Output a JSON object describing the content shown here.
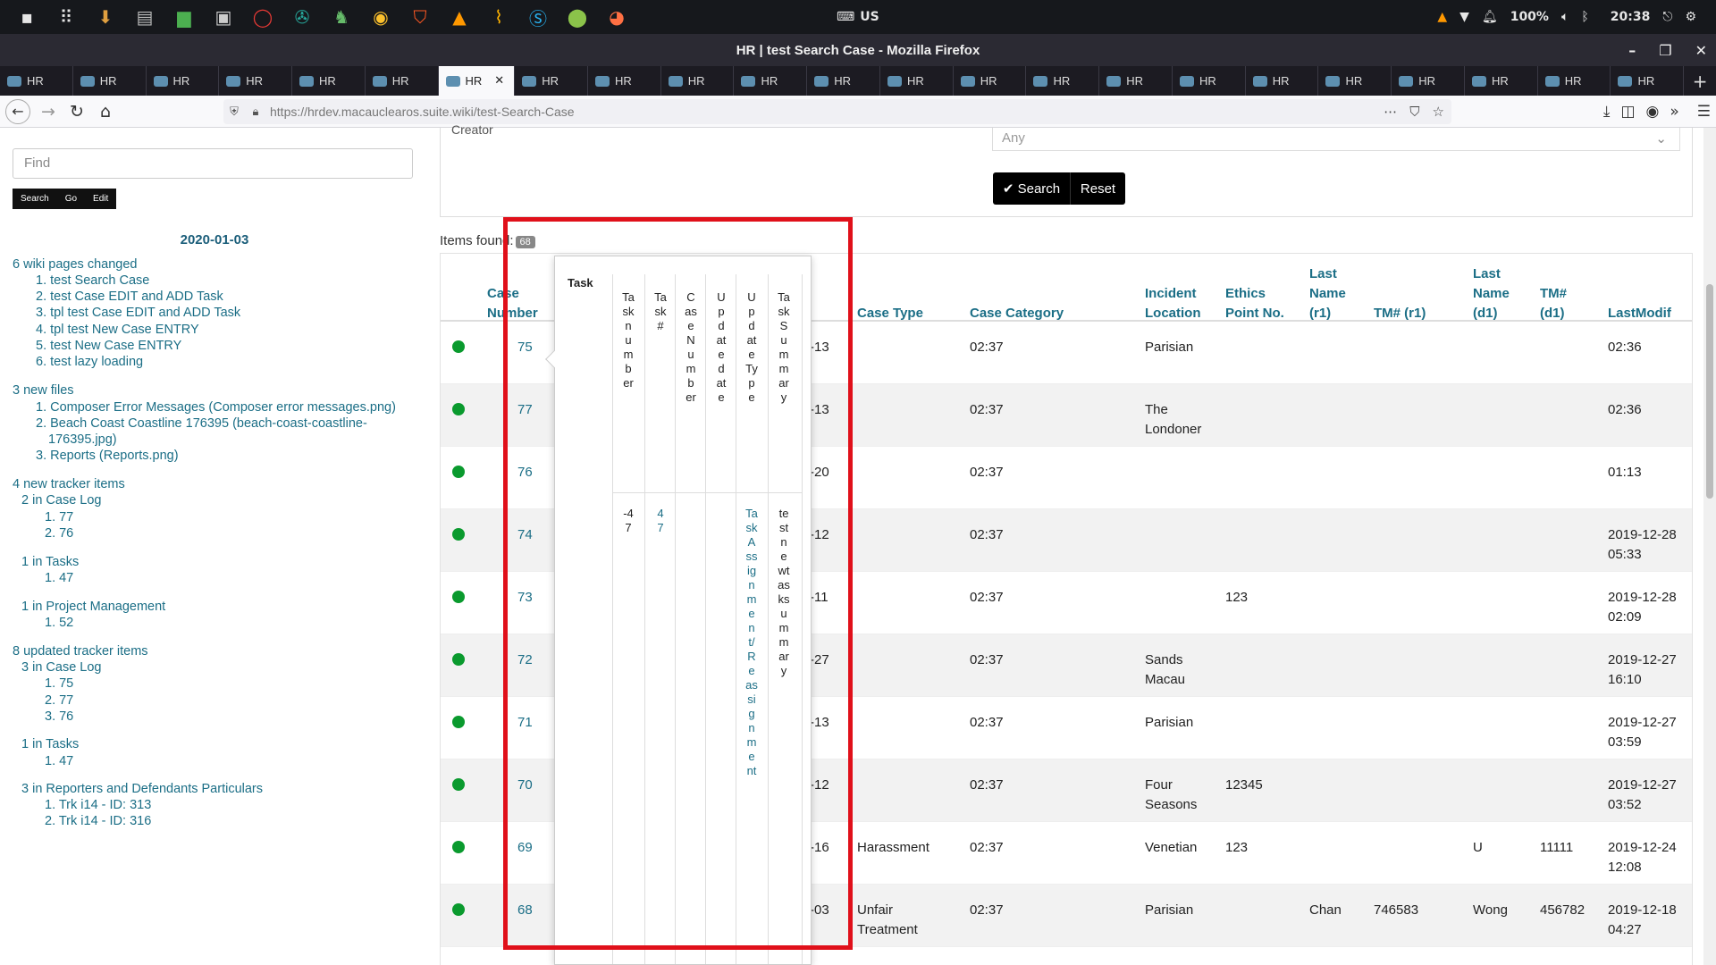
{
  "system_bar": {
    "keyboard_layout": "US",
    "battery": "100%",
    "clock": "20:38",
    "launcher_icons": [
      "files-icon",
      "app-grid-icon",
      "downloads-icon",
      "disk-icon",
      "folder-icon",
      "terminal-icon",
      "opera-icon",
      "aperture-icon",
      "security-icon",
      "chrome-icon",
      "brave-icon",
      "vlc-icon",
      "broom-icon",
      "skype-icon",
      "maps-icon",
      "firefox-icon"
    ]
  },
  "window": {
    "title": "HR | test Search Case - Mozilla Firefox"
  },
  "tabs": {
    "labels": [
      "HR",
      "HR",
      "HR",
      "HR",
      "HR",
      "HR",
      "HR",
      "HR",
      "HR",
      "HR",
      "HR",
      "HR",
      "HR",
      "HR",
      "HR",
      "HR",
      "HR",
      "HR",
      "HR",
      "HR",
      "HR",
      "HR",
      "HR"
    ],
    "active_index": 6
  },
  "address_bar": {
    "url": "https://hrdev.macauclearos.suite.wiki/test-Search-Case"
  },
  "sidebar": {
    "find_placeholder": "Find",
    "buttons": [
      "Search",
      "Go",
      "Edit"
    ],
    "date": "2020-01-03",
    "lines": [
      "6 wiki pages changed",
      "1. test Search Case",
      "2. test Case EDIT and ADD Task",
      "3. tpl test Case EDIT and ADD Task",
      "4. tpl test New Case ENTRY",
      "5. test New Case ENTRY",
      "6. test lazy loading",
      "3 new files",
      "1. Composer Error Messages (Composer error messages.png)",
      "2. Beach Coast Coastline 176395 (beach-coast-coastline-",
      "176395.jpg)",
      "3. Reports (Reports.png)",
      "4 new tracker items",
      "2 in Case Log",
      "1. 77",
      "2. 76",
      "1 in Tasks",
      "1. 47",
      "1 in Project Management",
      "1. 52",
      "8 updated tracker items",
      "3 in Case Log",
      "1. 75",
      "2. 77",
      "3. 76",
      "1 in Tasks",
      "1. 47",
      "3 in Reporters and Defendants Particulars",
      "1. Trk i14 - ID: 313",
      "2. Trk i14 - ID: 316"
    ]
  },
  "filter": {
    "creator_label": "Creator",
    "creator_value": "Any",
    "search_label": "✔ Search",
    "reset_label": "Reset"
  },
  "results": {
    "items_found_label": "Items found:",
    "items_count": "68",
    "headers": {
      "case_number": "Case Number",
      "case_type": "Case Type",
      "case_category": "Case Category",
      "incident_location": "Incident Location",
      "ethics_point": "Ethics Point No.",
      "last_name_r1": "Last Name (r1)",
      "tm_r1": "TM# (r1)",
      "last_name_d1": "Last Name (d1)",
      "tm_d1": "TM# (d1)",
      "last_modif": "LastModif"
    },
    "rows": [
      {
        "case": "75",
        "date_frag": "-13",
        "type": "",
        "category": "02:37",
        "location": "Parisian",
        "ethics": "",
        "ln_r1": "",
        "tm_r1": "",
        "ln_d1": "",
        "tm_d1": "",
        "modif": "02:36"
      },
      {
        "case": "77",
        "date_frag": "-13",
        "type": "",
        "category": "02:37",
        "location": "The Londoner",
        "ethics": "",
        "ln_r1": "",
        "tm_r1": "",
        "ln_d1": "",
        "tm_d1": "",
        "modif": "02:36"
      },
      {
        "case": "76",
        "date_frag": "-20",
        "type": "",
        "category": "02:37",
        "location": "",
        "ethics": "",
        "ln_r1": "",
        "tm_r1": "",
        "ln_d1": "",
        "tm_d1": "",
        "modif": "01:13"
      },
      {
        "case": "74",
        "date_frag": "-12",
        "type": "",
        "category": "02:37",
        "location": "",
        "ethics": "",
        "ln_r1": "",
        "tm_r1": "",
        "ln_d1": "",
        "tm_d1": "",
        "modif": "2019-12-28 05:33"
      },
      {
        "case": "73",
        "date_frag": "-11",
        "type": "",
        "category": "02:37",
        "location": "",
        "ethics": "123",
        "ln_r1": "",
        "tm_r1": "",
        "ln_d1": "",
        "tm_d1": "",
        "modif": "2019-12-28 02:09"
      },
      {
        "case": "72",
        "date_frag": "-27",
        "type": "",
        "category": "02:37",
        "location": "Sands Macau",
        "ethics": "",
        "ln_r1": "",
        "tm_r1": "",
        "ln_d1": "",
        "tm_d1": "",
        "modif": "2019-12-27 16:10"
      },
      {
        "case": "71",
        "date_frag": "-13",
        "type": "",
        "category": "02:37",
        "location": "Parisian",
        "ethics": "",
        "ln_r1": "",
        "tm_r1": "",
        "ln_d1": "",
        "tm_d1": "",
        "modif": "2019-12-27 03:59"
      },
      {
        "case": "70",
        "date_frag": "-12",
        "type": "",
        "category": "02:37",
        "location": "Four Seasons",
        "ethics": "12345",
        "ln_r1": "",
        "tm_r1": "",
        "ln_d1": "",
        "tm_d1": "",
        "modif": "2019-12-27 03:52"
      },
      {
        "case": "69",
        "date_frag": "-16",
        "type": "Harassment",
        "category": "02:37",
        "location": "Venetian",
        "ethics": "123",
        "ln_r1": "",
        "tm_r1": "",
        "ln_d1": "U",
        "tm_d1": "11111",
        "modif": "2019-12-24 12:08"
      },
      {
        "case": "68",
        "date_frag": "-03",
        "type": "Unfair Treatment",
        "category": "02:37",
        "location": "Parisian",
        "ethics": "",
        "ln_r1": "Chan",
        "tm_r1": "746583",
        "ln_d1": "Wong",
        "tm_d1": "456782",
        "modif": "2019-12-18 04:27"
      }
    ]
  },
  "popover": {
    "title": "Task",
    "columns": [
      "Tasknumber",
      "Task#",
      "CaseNumber",
      "Updatedate",
      "UpdateType",
      "TaskSummary"
    ],
    "values": [
      "-47",
      "47",
      "",
      "",
      "TaskAssignment/Reassignment",
      "testnewtasksummary"
    ],
    "link_columns": [
      1,
      4
    ]
  },
  "annotation": {
    "highlight_color": "#e0101a"
  }
}
